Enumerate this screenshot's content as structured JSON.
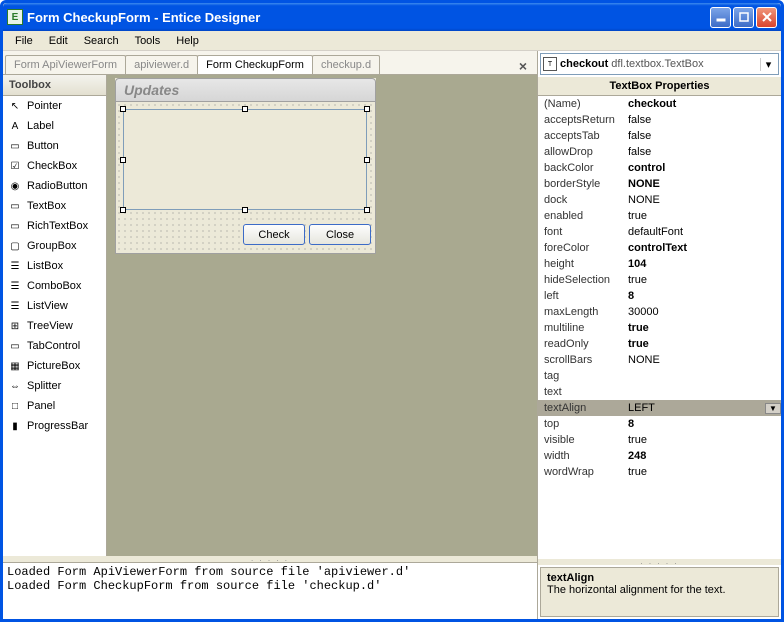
{
  "title": "Form CheckupForm - Entice Designer",
  "menu": [
    "File",
    "Edit",
    "Search",
    "Tools",
    "Help"
  ],
  "tabs": [
    {
      "label": "Form ApiViewerForm",
      "active": false
    },
    {
      "label": "apiviewer.d",
      "active": false
    },
    {
      "label": "Form CheckupForm",
      "active": true
    },
    {
      "label": "checkup.d",
      "active": false
    }
  ],
  "toolbox": {
    "header": "Toolbox",
    "items": [
      {
        "name": "Pointer",
        "glyph": "↖"
      },
      {
        "name": "Label",
        "glyph": "A"
      },
      {
        "name": "Button",
        "glyph": "▭"
      },
      {
        "name": "CheckBox",
        "glyph": "☑"
      },
      {
        "name": "RadioButton",
        "glyph": "◉"
      },
      {
        "name": "TextBox",
        "glyph": "▭"
      },
      {
        "name": "RichTextBox",
        "glyph": "▭"
      },
      {
        "name": "GroupBox",
        "glyph": "▢"
      },
      {
        "name": "ListBox",
        "glyph": "☰"
      },
      {
        "name": "ComboBox",
        "glyph": "☰"
      },
      {
        "name": "ListView",
        "glyph": "☰"
      },
      {
        "name": "TreeView",
        "glyph": "⊞"
      },
      {
        "name": "TabControl",
        "glyph": "▭"
      },
      {
        "name": "PictureBox",
        "glyph": "▦"
      },
      {
        "name": "Splitter",
        "glyph": "⇔"
      },
      {
        "name": "Panel",
        "glyph": "□"
      },
      {
        "name": "ProgressBar",
        "glyph": "▮"
      }
    ]
  },
  "designer_form": {
    "title": "Updates",
    "check_btn": "Check",
    "close_btn": "Close"
  },
  "output_lines": "Loaded Form ApiViewerForm from source file 'apiviewer.d'\nLoaded Form CheckupForm from source file 'checkup.d'",
  "object_selector": {
    "name": "checkout",
    "type": "dfl.textbox.TextBox"
  },
  "props_header": "TextBox Properties",
  "props": [
    {
      "name": "(Name)",
      "value": "checkout",
      "bold": true
    },
    {
      "name": "acceptsReturn",
      "value": "false",
      "bold": false
    },
    {
      "name": "acceptsTab",
      "value": "false",
      "bold": false
    },
    {
      "name": "allowDrop",
      "value": "false",
      "bold": false
    },
    {
      "name": "backColor",
      "value": "control",
      "bold": true
    },
    {
      "name": "borderStyle",
      "value": "NONE",
      "bold": true
    },
    {
      "name": "dock",
      "value": "NONE",
      "bold": false
    },
    {
      "name": "enabled",
      "value": "true",
      "bold": false
    },
    {
      "name": "font",
      "value": "defaultFont",
      "bold": false
    },
    {
      "name": "foreColor",
      "value": "controlText",
      "bold": true
    },
    {
      "name": "height",
      "value": "104",
      "bold": true
    },
    {
      "name": "hideSelection",
      "value": "true",
      "bold": false
    },
    {
      "name": "left",
      "value": "8",
      "bold": true
    },
    {
      "name": "maxLength",
      "value": "30000",
      "bold": false
    },
    {
      "name": "multiline",
      "value": "true",
      "bold": true
    },
    {
      "name": "readOnly",
      "value": "true",
      "bold": true
    },
    {
      "name": "scrollBars",
      "value": "NONE",
      "bold": false
    },
    {
      "name": "tag",
      "value": "",
      "bold": false
    },
    {
      "name": "text",
      "value": "",
      "bold": false
    },
    {
      "name": "textAlign",
      "value": "LEFT",
      "bold": false,
      "selected": true
    },
    {
      "name": "top",
      "value": "8",
      "bold": true
    },
    {
      "name": "visible",
      "value": "true",
      "bold": false
    },
    {
      "name": "width",
      "value": "248",
      "bold": true
    },
    {
      "name": "wordWrap",
      "value": "true",
      "bold": false
    }
  ],
  "prop_desc": {
    "title": "textAlign",
    "text": "The horizontal alignment for the text."
  }
}
